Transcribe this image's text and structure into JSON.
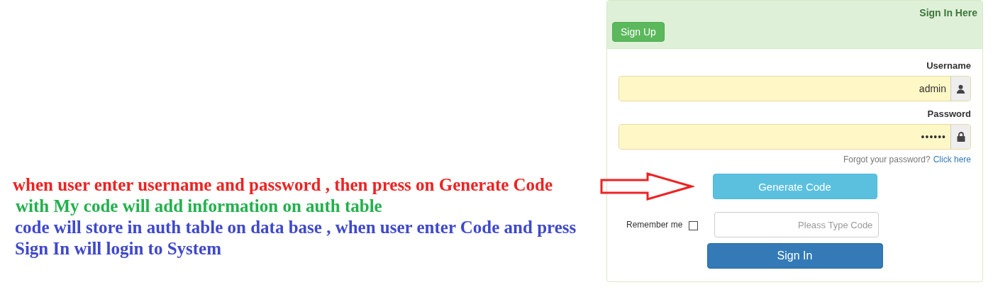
{
  "notes": [
    {
      "text": "when user enter username and password , then press on Generate Code",
      "color": "#ee2222"
    },
    {
      "text": "with My code will add information on auth table",
      "color": "#22b14c"
    },
    {
      "text": "code will store in auth table on data base , when user enter Code and press Sign In will login to System",
      "color": "#3f48cc"
    }
  ],
  "panel": {
    "title": "Sign In Here",
    "signup_button": "Sign Up",
    "username": {
      "label": "Username",
      "value": "admin"
    },
    "password": {
      "label": "Password",
      "value": "••••••"
    },
    "forgot": {
      "text": "Forgot your password?",
      "link": "Click here"
    },
    "generate_button": "Generate Code",
    "remember": {
      "label": "Remember me",
      "checked": false
    },
    "code": {
      "placeholder": "Pleass Type Code"
    },
    "signin_button": "Sign In"
  }
}
